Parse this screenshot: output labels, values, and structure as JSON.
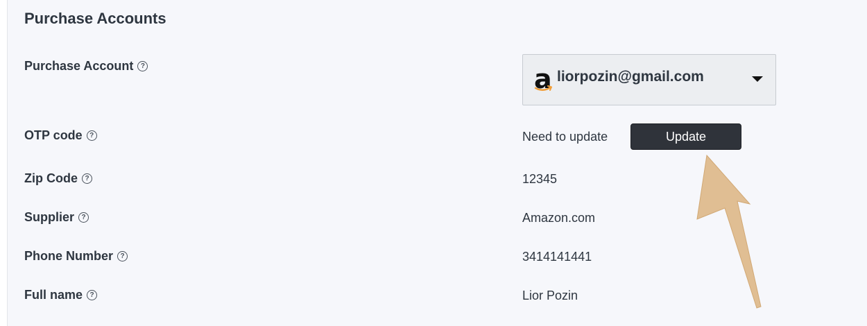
{
  "section": {
    "title": "Purchase Accounts"
  },
  "fields": {
    "purchase_account": {
      "label": "Purchase Account",
      "value": "liorpozin@gmail.com",
      "icon": "amazon-logo"
    },
    "otp_code": {
      "label": "OTP code",
      "status": "Need to update",
      "button_label": "Update"
    },
    "zip_code": {
      "label": "Zip Code",
      "value": "12345"
    },
    "supplier": {
      "label": "Supplier",
      "value": "Amazon.com"
    },
    "phone_number": {
      "label": "Phone Number",
      "value": "3414141441"
    },
    "full_name": {
      "label": "Full name",
      "value": "Lior Pozin"
    }
  },
  "help_glyph": "?",
  "colors": {
    "panel_background": "#f6f7fb",
    "text": "#2e3640",
    "button_background": "#2f333a",
    "annotation_arrow": "#ddb98a"
  }
}
